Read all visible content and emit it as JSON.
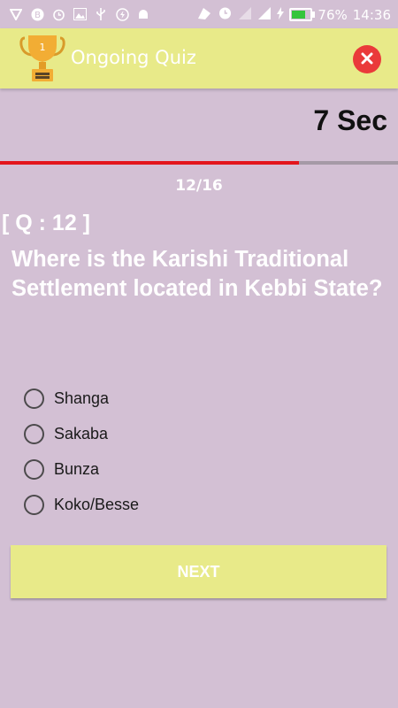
{
  "status_bar": {
    "left_icons": [
      "vpn-icon",
      "b-icon",
      "alarm-icon",
      "image-icon",
      "usb-icon",
      "flash-icon",
      "android-icon"
    ],
    "battery_percent": "76%",
    "battery_level": 0.76,
    "time": "14:36"
  },
  "header": {
    "title": "Ongoing Quiz",
    "trophy_number": "1",
    "close_icon": "close-icon"
  },
  "timer": {
    "label": "7 Sec",
    "progress_fraction": 0.75
  },
  "quiz": {
    "counter": "12/16",
    "question_label": "[ Q : 12 ]",
    "question_text": "Where is the Karishi Traditional Settlement located in Kebbi State?",
    "options": [
      "Shanga",
      "Sakaba",
      "Bunza",
      "Koko/Besse"
    ]
  },
  "actions": {
    "next_label": "NEXT"
  },
  "colors": {
    "background": "#d3c0d4",
    "toolbar": "#e8ea89",
    "progress": "#e3151c",
    "close": "#ea3a3a"
  }
}
